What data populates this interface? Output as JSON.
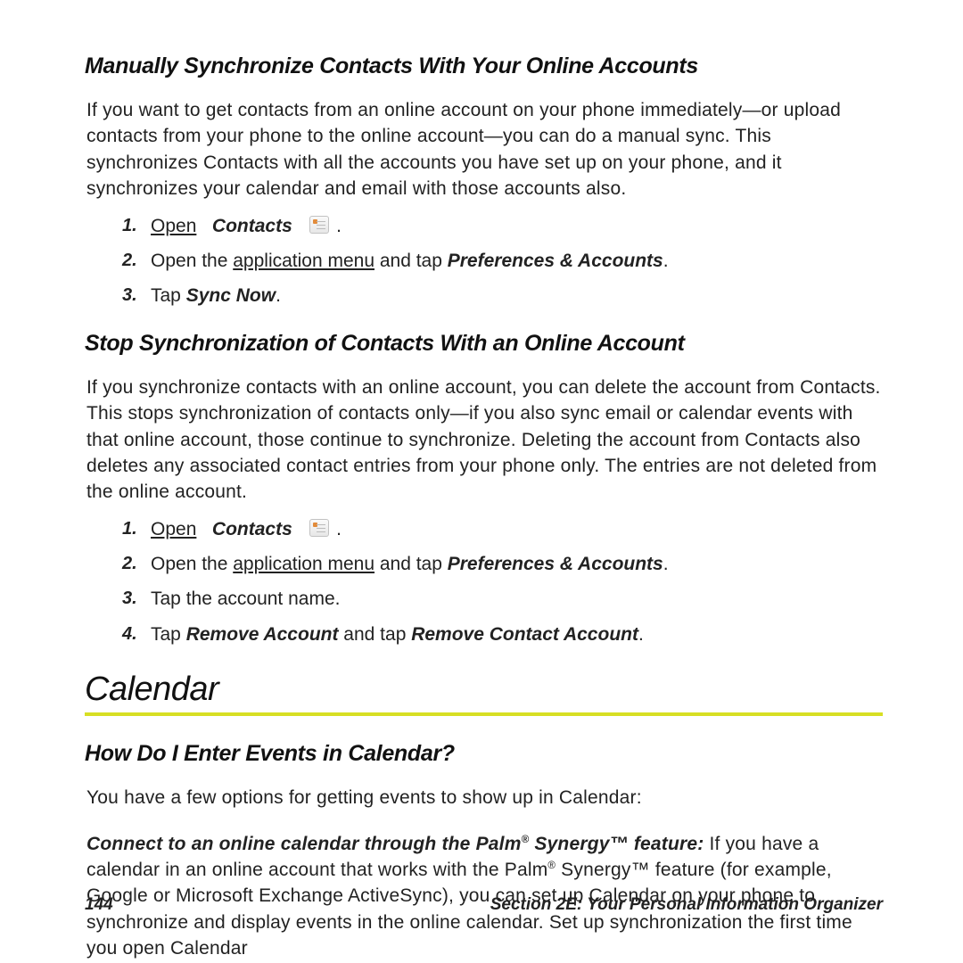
{
  "sec1": {
    "heading": "Manually Synchronize Contacts With Your Online Accounts",
    "para": "If you want to get contacts from an online account on your phone immediately—or upload contacts from your phone to the online account—you can do a manual sync. This synchronizes Contacts with all the accounts you have set up on your phone, and it synchronizes your calendar and email with those accounts also.",
    "step1_open": "Open",
    "step1_contacts": "Contacts",
    "step2_a": "Open the ",
    "step2_link": "application menu",
    "step2_b": " and tap ",
    "step2_em": "Preferences & Accounts",
    "step3_a": "Tap ",
    "step3_em": "Sync Now"
  },
  "sec2": {
    "heading": "Stop Synchronization of Contacts With an Online Account",
    "para": "If you synchronize contacts with an online account, you can delete the account from Contacts. This stops synchronization of contacts only—if you also sync email or calendar events with that online account, those continue to synchronize. Deleting the account from Contacts also deletes any associated contact entries from your phone only. The entries are not deleted from the online account.",
    "step1_open": "Open",
    "step1_contacts": "Contacts",
    "step2_a": "Open the ",
    "step2_link": "application menu",
    "step2_b": " and tap ",
    "step2_em": "Preferences & Accounts",
    "step3": "Tap the account name.",
    "step4_a": "Tap ",
    "step4_em1": "Remove Account",
    "step4_b": " and tap ",
    "step4_em2": "Remove Contact Account"
  },
  "calendar": {
    "title": "Calendar",
    "q_heading": "How Do I Enter Events in Calendar?",
    "para_intro": "You have a few options for getting events to show up in Calendar:",
    "opt_em_a": "Connect to an online calendar through the Palm",
    "opt_em_b": " Synergy™ feature:",
    "opt_rest_a": " If you have a calendar in an online account that works with the Palm",
    "opt_rest_b": " Synergy™ feature (for example, Google or Microsoft Exchange ActiveSync), you can set up Calendar on your phone to synchronize and display events in the online calendar. Set up synchronization the first time you open Calendar"
  },
  "footer": {
    "page": "144",
    "section": "Section 2E: Your Personal Information Organizer"
  }
}
